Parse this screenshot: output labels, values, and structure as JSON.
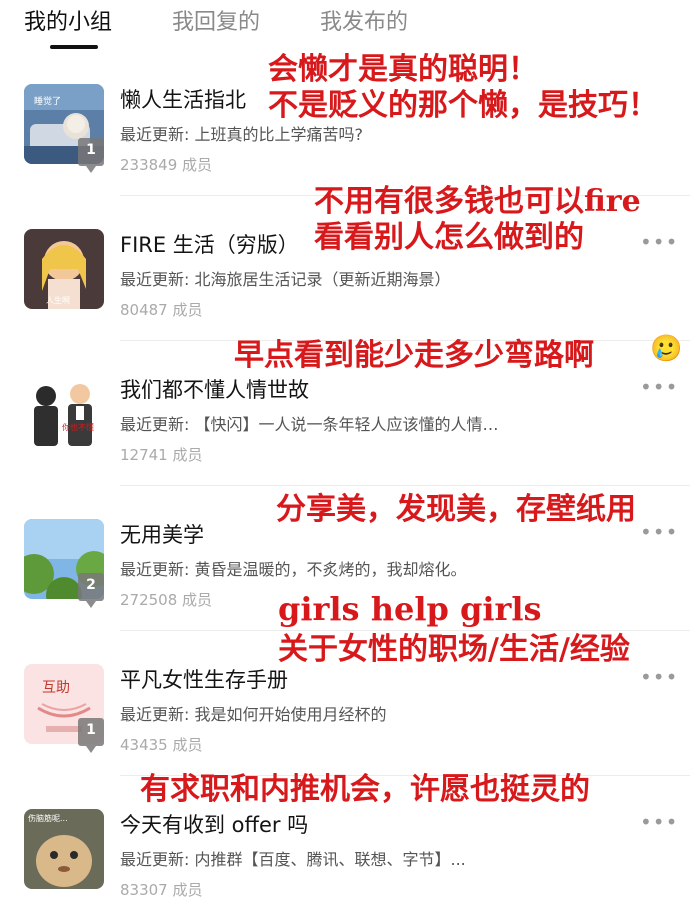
{
  "tabs": [
    {
      "label": "我的小组",
      "active": true
    },
    {
      "label": "我回复的",
      "active": false
    },
    {
      "label": "我发布的",
      "active": false
    }
  ],
  "more_label": "•••",
  "groups": [
    {
      "title": "懒人生活指北",
      "latest": "最近更新: 上班真的比上学痛苦吗?",
      "members": "233849 成员",
      "badge": "1",
      "thumb_text": "睡觉了"
    },
    {
      "title": "FIRE 生活（穷版）",
      "latest": "最近更新: 北海旅居生活记录（更新近期海景）",
      "members": "80487 成员",
      "badge": "",
      "thumb_text": "人生啊"
    },
    {
      "title": "我们都不懂人情世故",
      "latest": "最近更新: 【快闪】一人说一条年轻人应该懂的人情…",
      "members": "12741 成员",
      "badge": "",
      "thumb_text": "你也不懂"
    },
    {
      "title": "无用美学",
      "latest": "最近更新: 黄昏是温暖的，不炙烤的，我却熔化。",
      "members": "272508 成员",
      "badge": "2",
      "thumb_text": ""
    },
    {
      "title": "平凡女性生存手册",
      "latest": "最近更新: 我是如何开始使用月经杯的",
      "members": "43435 成员",
      "badge": "1",
      "thumb_text": "互助"
    },
    {
      "title": "今天有收到 offer 吗",
      "latest": "最近更新: 内推群【百度、腾讯、联想、字节】...",
      "members": "83307 成员",
      "badge": "",
      "thumb_text": "伤脑筋呢..."
    }
  ],
  "annotations": [
    {
      "line1": "会懒才是真的聪明！",
      "line2": "不是贬义的那个懒，是技巧！"
    },
    {
      "line1": "不用有很多钱也可以fire",
      "line2": "看看别人怎么做到的"
    },
    {
      "line1": "早点看到能少走多少弯路啊",
      "emoji": "🥲"
    },
    {
      "line1": "分享美，发现美，存壁纸用"
    },
    {
      "line1": "girls help girls",
      "line2": "关于女性的职场/生活/经验"
    },
    {
      "line1": "有求职和内推机会，许愿也挺灵的"
    }
  ],
  "colors": {
    "annotation": "#d7191c",
    "tab_active": "#111111",
    "tab_inactive": "#8a8a8a",
    "member_text": "#aaaaaa"
  }
}
